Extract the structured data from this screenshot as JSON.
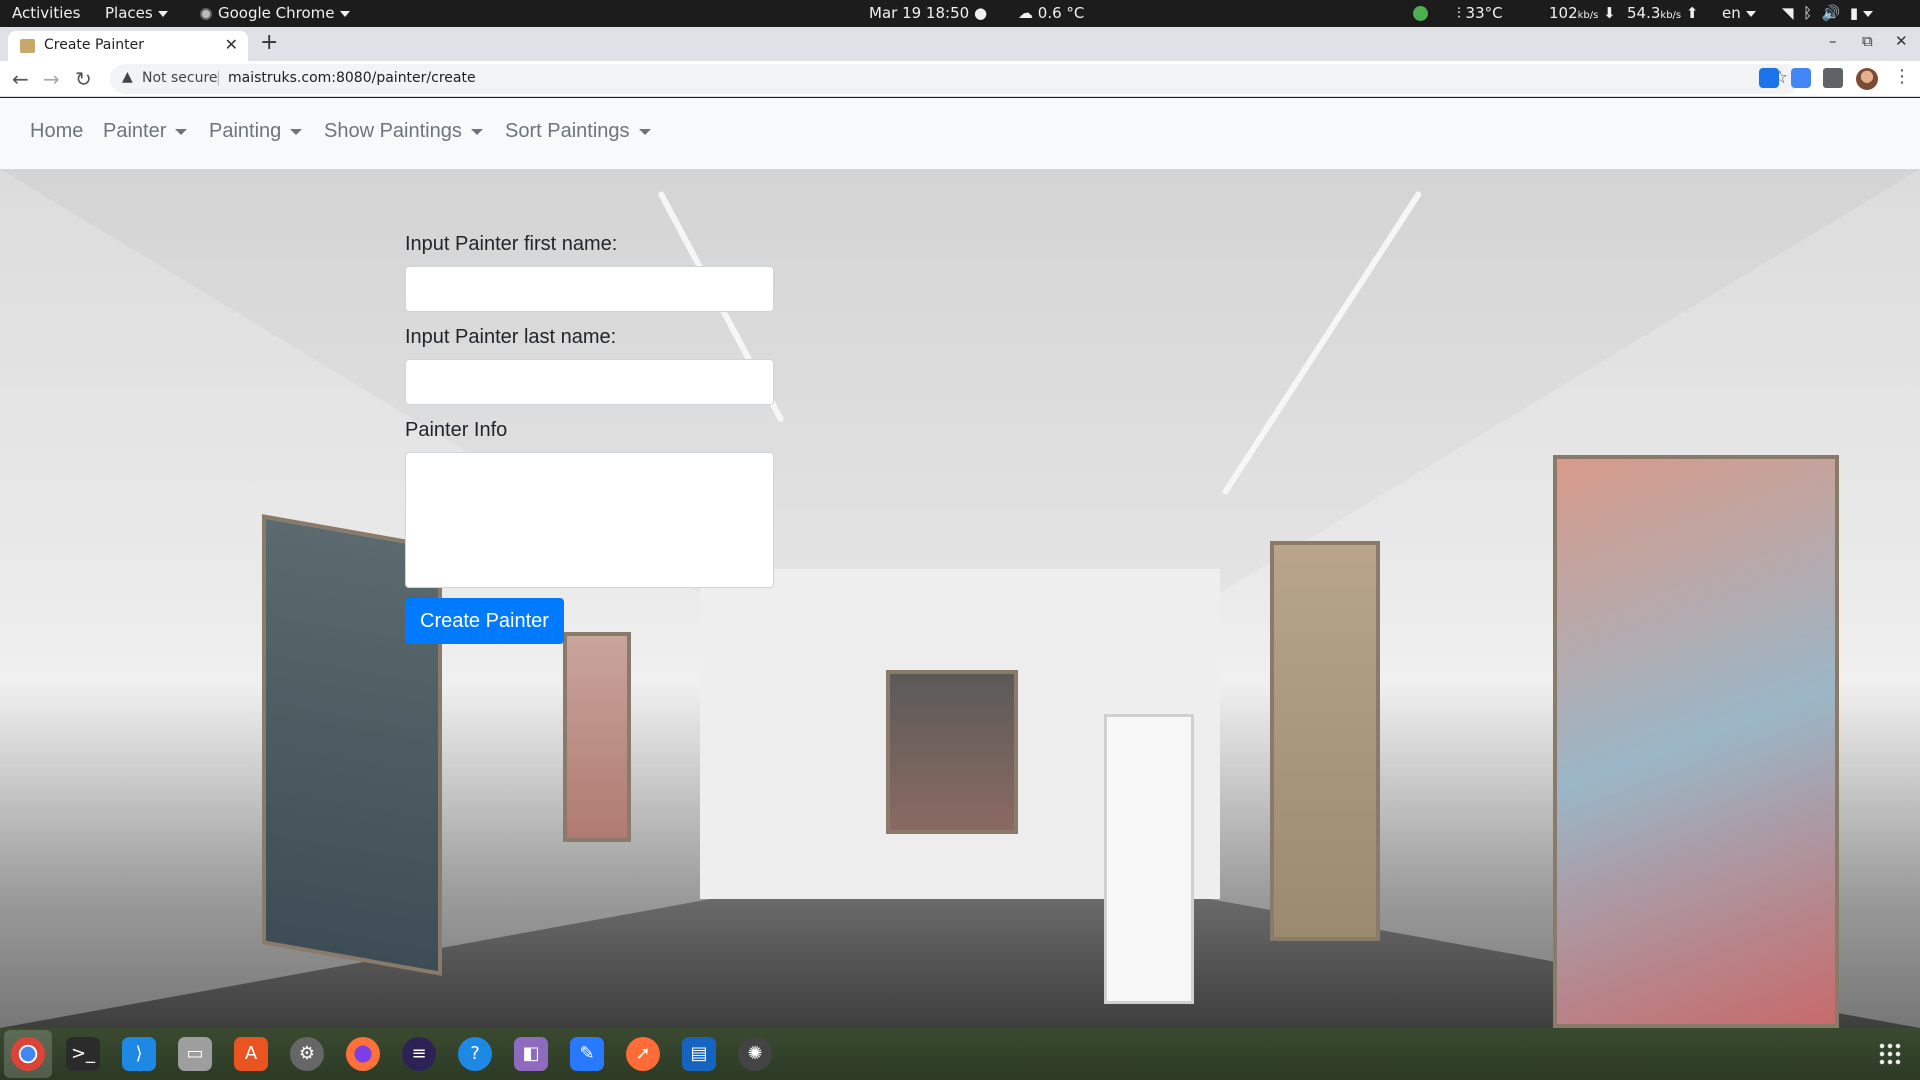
{
  "system_bar": {
    "activities": "Activities",
    "places": "Places",
    "app_name": "Google Chrome",
    "datetime": "Mar 19  18:50",
    "weather": "0.6 °C",
    "cpu_temp": "33°C",
    "net_down": "102",
    "net_down_unit": "kb/s",
    "net_up": "54.3",
    "net_up_unit": "kb/s",
    "language": "en"
  },
  "browser": {
    "tab_title": "Create Painter",
    "security_label": "Not secure",
    "url": "maistruks.com:8080/painter/create"
  },
  "navbar": {
    "items": [
      {
        "label": "Home"
      },
      {
        "label": "Painter"
      },
      {
        "label": "Painting"
      },
      {
        "label": "Show Paintings"
      },
      {
        "label": "Sort Paintings"
      }
    ]
  },
  "form": {
    "first_name_label": "Input Painter first name:",
    "first_name_value": "",
    "last_name_label": "Input Painter last name:",
    "last_name_value": "",
    "info_label": "Painter Info",
    "info_value": "",
    "submit_label": "Create Painter"
  },
  "colors": {
    "primary_button": "#007bff",
    "navbar_bg": "#f8f9fa",
    "nav_link": "#6c757d"
  },
  "dock": {
    "icons": [
      "chrome-icon",
      "terminal-icon",
      "vscode-icon",
      "files-icon",
      "software-center-icon",
      "settings-icon",
      "firefox-icon",
      "eclipse-icon",
      "help-icon",
      "toolbox-icon",
      "text-editor-icon",
      "postman-icon",
      "document-viewer-icon",
      "gear-app-icon"
    ]
  }
}
